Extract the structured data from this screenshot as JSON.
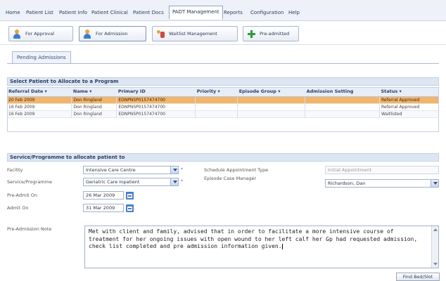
{
  "menu": [
    "Home",
    "Patient List",
    "Patient Info",
    "Patient Clinical",
    "Patient Docs",
    "PADT Management",
    "Reports",
    "Configuration",
    "Help"
  ],
  "toolbar": {
    "for_approval": "For Approval",
    "for_admission": "For Admission",
    "waitlist": "Waitlist Management",
    "pre_admitted": "Pre-admitted"
  },
  "tab": "Pending Admissions",
  "patient_section_title": "Select Patient to Allocate to a Program",
  "table": {
    "headers": [
      "Referral Date",
      "Name",
      "Primary ID",
      "Priority",
      "Episode Group",
      "Admission Setting",
      "Status"
    ],
    "rows": [
      [
        "20 Feb 2009",
        "Don Ringland",
        "EDNPN5P0157474700",
        "",
        "",
        "",
        "Referral Approved"
      ],
      [
        "16 Feb 2009",
        "Don Ringland",
        "EDNPN5P0157474700",
        "",
        "",
        "",
        "Referral Approved"
      ],
      [
        "16 Feb 2009",
        "Don Ringland",
        "EDNPN5P0157474700",
        "",
        "",
        "",
        "Waitlisted"
      ]
    ]
  },
  "service_section_title": "Service/Programme to allocate patient to",
  "form": {
    "facility_label": "Facility",
    "facility_value": "Intensive Care Centre",
    "program_label": "Service/Programme",
    "program_value": "Geriatric Care Inpatient",
    "preadmit_label": "Pre-Admit On",
    "preadmit_value": "26 Mar 2009",
    "admit_label": "Admit On",
    "admit_value": "31 Mar 2009",
    "appt_type_label": "Schedule Appointment Type",
    "appt_type_value": "Initial Appointment",
    "case_mgr_label": "Episode Case Manager",
    "case_mgr_value": "Richardson, Dan",
    "notes_label": "Pre-Admission Note",
    "notes_value": "Met with client and family, advised that in order to facilitate a more intensive course of treatment for her ongoing issues with open wound to her left calf her Gp had requested admission, check list completed and pre admission information given."
  },
  "find_bed_label": "Find Bed/Slot",
  "colors": {
    "selected_row": "#f2b56a",
    "section_bar": "#dde6f3",
    "calendar": "#4a7fc8"
  }
}
